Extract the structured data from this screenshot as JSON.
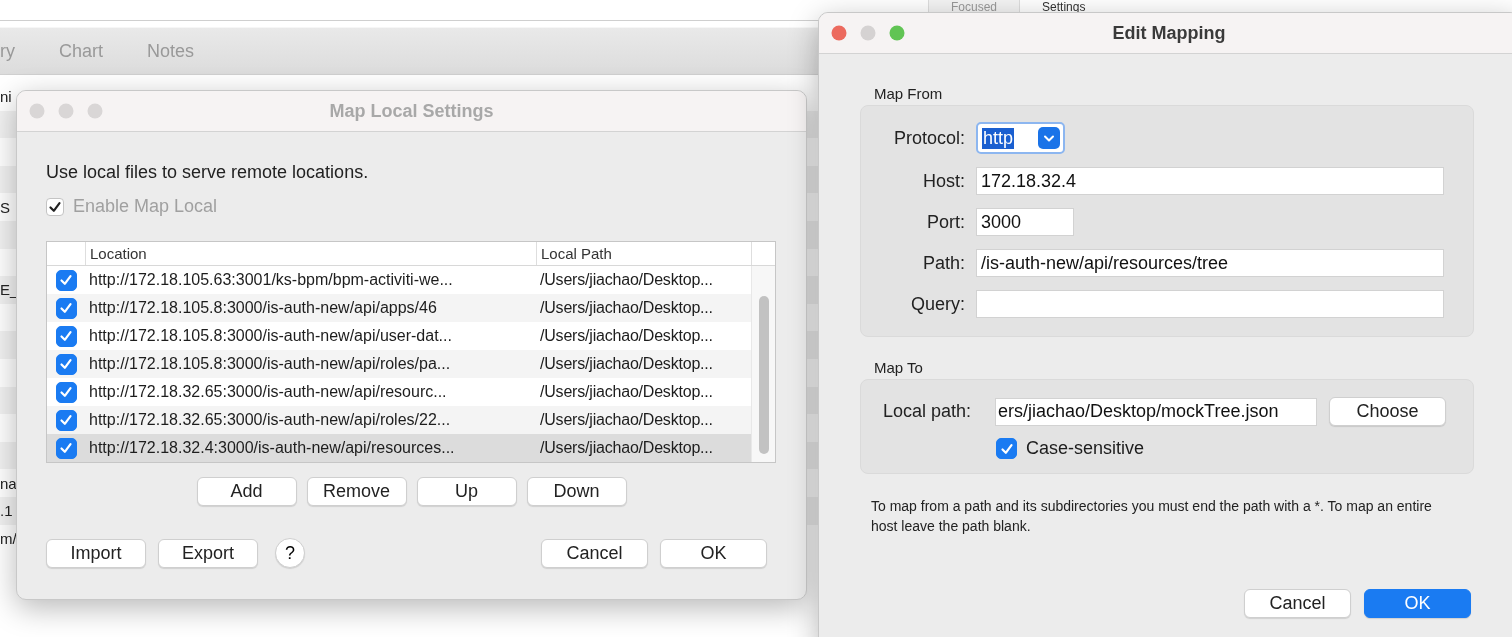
{
  "background_window": {
    "top_tabs": [
      {
        "label": "Focused",
        "selected": false
      },
      {
        "label": "Settings",
        "selected": true
      }
    ],
    "tabs": [
      {
        "label": "ry",
        "selected": false
      },
      {
        "label": "Chart",
        "selected": false
      },
      {
        "label": "Notes",
        "selected": false
      }
    ],
    "rows": [
      {
        "text": "ni"
      },
      {},
      {},
      {},
      {
        "text": "S"
      },
      {},
      {},
      {
        "text": "E_"
      },
      {},
      {},
      {},
      {},
      {},
      {},
      {
        "text": "na"
      },
      {
        "text": ".1"
      },
      {
        "text": "m/"
      }
    ]
  },
  "map_local_dialog": {
    "title": "Map Local Settings",
    "active": false,
    "description": "Use local files to serve remote locations.",
    "enable": {
      "label": "Enable Map Local",
      "checked": true,
      "disabled": true
    },
    "table": {
      "columns": [
        "Location",
        "Local Path"
      ],
      "rows": [
        {
          "checked": true,
          "selected": false,
          "location": "http://172.18.105.63:3001/ks-bpm/bpm-activiti-we...",
          "local_path": "/Users/jiachao/Desktop..."
        },
        {
          "checked": true,
          "selected": false,
          "location": "http://172.18.105.8:3000/is-auth-new/api/apps/46",
          "local_path": "/Users/jiachao/Desktop..."
        },
        {
          "checked": true,
          "selected": false,
          "location": "http://172.18.105.8:3000/is-auth-new/api/user-dat...",
          "local_path": "/Users/jiachao/Desktop..."
        },
        {
          "checked": true,
          "selected": false,
          "location": "http://172.18.105.8:3000/is-auth-new/api/roles/pa...",
          "local_path": "/Users/jiachao/Desktop..."
        },
        {
          "checked": true,
          "selected": false,
          "location": "http://172.18.32.65:3000/is-auth-new/api/resourc...",
          "local_path": "/Users/jiachao/Desktop..."
        },
        {
          "checked": true,
          "selected": false,
          "location": "http://172.18.32.65:3000/is-auth-new/api/roles/22...",
          "local_path": "/Users/jiachao/Desktop..."
        },
        {
          "checked": true,
          "selected": true,
          "location": "http://172.18.32.4:3000/is-auth-new/api/resources...",
          "local_path": "/Users/jiachao/Desktop..."
        }
      ]
    },
    "row_buttons": [
      "Add",
      "Remove",
      "Up",
      "Down"
    ],
    "left_buttons": [
      "Import",
      "Export"
    ],
    "help": "?",
    "right_buttons": [
      {
        "label": "Cancel",
        "default": false
      },
      {
        "label": "OK",
        "default": false
      }
    ]
  },
  "edit_mapping_window": {
    "title": "Edit Mapping",
    "active": true,
    "map_from": {
      "label": "Map From",
      "protocol": {
        "label": "Protocol:",
        "value": "http",
        "text_selected": true
      },
      "host": {
        "label": "Host:",
        "value": "172.18.32.4"
      },
      "port": {
        "label": "Port:",
        "value": "3000"
      },
      "path": {
        "label": "Path:",
        "value": "/is-auth-new/api/resources/tree"
      },
      "query": {
        "label": "Query:"
      }
    },
    "map_to": {
      "label": "Map To",
      "local_path": {
        "label": "Local path:",
        "value": "ers/jiachao/Desktop/mockTree.json"
      },
      "choose": "Choose",
      "case_sensitive": {
        "label": "Case-sensitive",
        "checked": true
      }
    },
    "note": "To map from a path and its subdirectories you must end the path with a *. To map an entire host leave the path blank.",
    "buttons": [
      {
        "label": "Cancel",
        "default": false
      },
      {
        "label": "OK",
        "default": true
      }
    ]
  }
}
